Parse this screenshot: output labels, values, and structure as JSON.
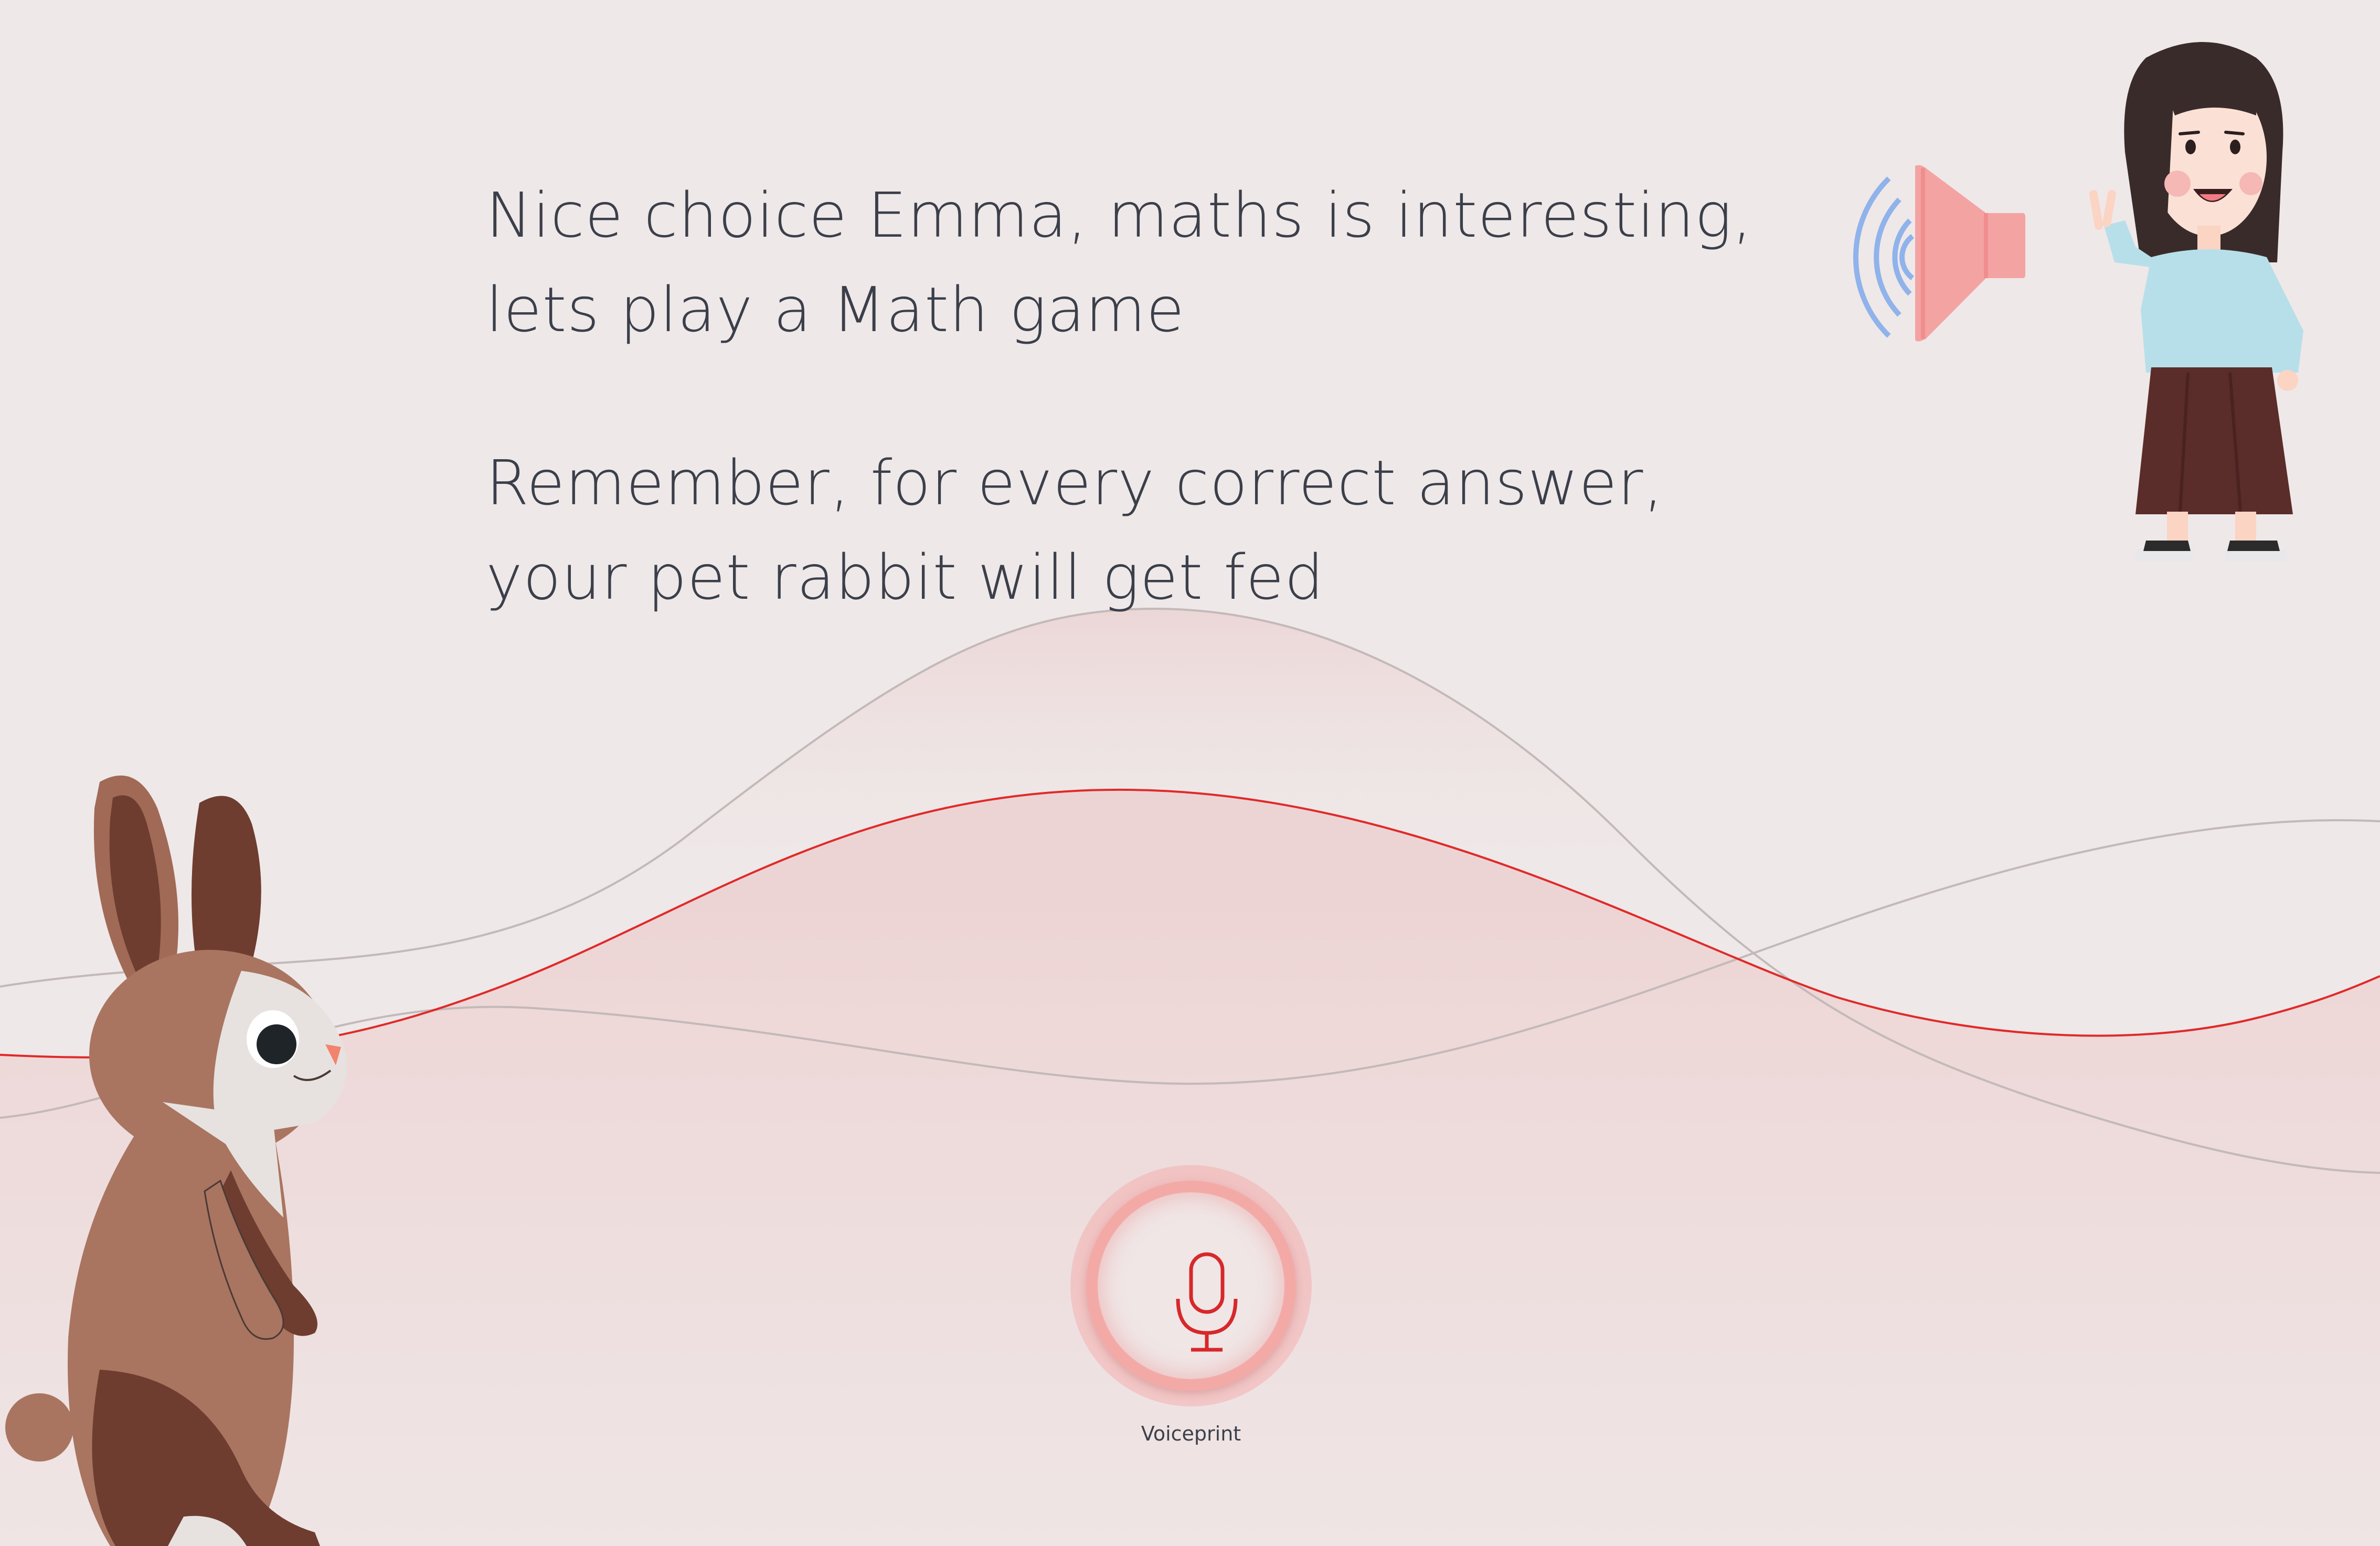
{
  "message": {
    "paragraph1_line1": "Nice choice Emma, maths is interesting,",
    "paragraph1_line2": "lets play a Math game",
    "paragraph2_line1": "Remember, for every correct answer,",
    "paragraph2_line2": "your pet rabbit will get fed"
  },
  "voice_button": {
    "label": "Voiceprint",
    "icon": "microphone-icon"
  },
  "speaker": {
    "icon": "speaker-icon"
  },
  "colors": {
    "background": "#efe8e8",
    "text": "#3b3f4a",
    "accent_red": "#e02a2a",
    "speaker_pink": "#f4a3a3",
    "sound_wave_blue": "#8fb3ea"
  }
}
